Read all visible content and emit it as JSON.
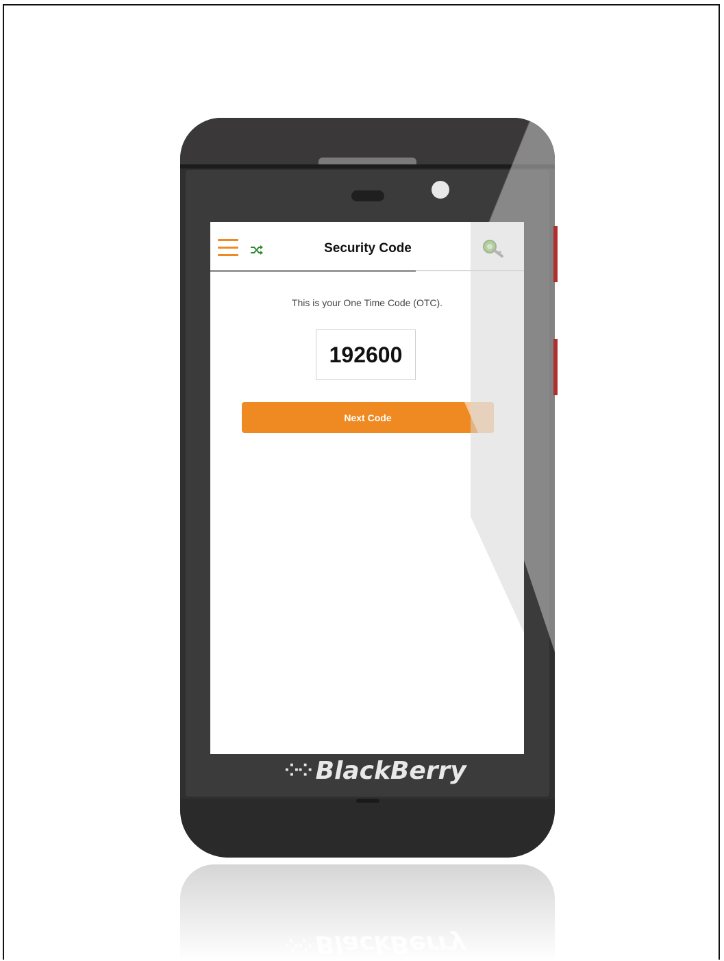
{
  "device": {
    "brand_label": "BlackBerry",
    "brand_mark": "⁘⁘"
  },
  "app": {
    "title": "Security Code",
    "icons": {
      "menu": "hamburger-menu-icon",
      "shuffle": "shuffle-icon",
      "key": "key-icon"
    },
    "colors": {
      "accent": "#ef8a22",
      "shuffle": "#2a8a2a",
      "key": "#6fae3e"
    }
  },
  "main": {
    "otc_label": "This is your One Time Code (OTC).",
    "code_value": "192600",
    "next_button_label": "Next Code"
  }
}
